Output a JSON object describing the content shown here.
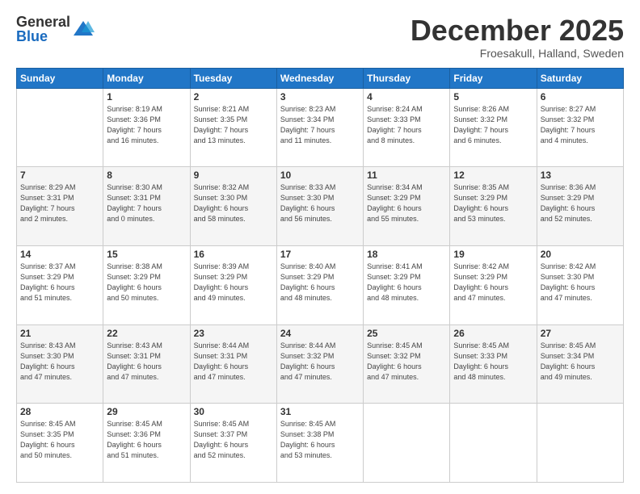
{
  "logo": {
    "general": "General",
    "blue": "Blue"
  },
  "header": {
    "month": "December 2025",
    "location": "Froesakull, Halland, Sweden"
  },
  "weekdays": [
    "Sunday",
    "Monday",
    "Tuesday",
    "Wednesday",
    "Thursday",
    "Friday",
    "Saturday"
  ],
  "weeks": [
    [
      {
        "day": "",
        "info": ""
      },
      {
        "day": "1",
        "info": "Sunrise: 8:19 AM\nSunset: 3:36 PM\nDaylight: 7 hours\nand 16 minutes."
      },
      {
        "day": "2",
        "info": "Sunrise: 8:21 AM\nSunset: 3:35 PM\nDaylight: 7 hours\nand 13 minutes."
      },
      {
        "day": "3",
        "info": "Sunrise: 8:23 AM\nSunset: 3:34 PM\nDaylight: 7 hours\nand 11 minutes."
      },
      {
        "day": "4",
        "info": "Sunrise: 8:24 AM\nSunset: 3:33 PM\nDaylight: 7 hours\nand 8 minutes."
      },
      {
        "day": "5",
        "info": "Sunrise: 8:26 AM\nSunset: 3:32 PM\nDaylight: 7 hours\nand 6 minutes."
      },
      {
        "day": "6",
        "info": "Sunrise: 8:27 AM\nSunset: 3:32 PM\nDaylight: 7 hours\nand 4 minutes."
      }
    ],
    [
      {
        "day": "7",
        "info": "Sunrise: 8:29 AM\nSunset: 3:31 PM\nDaylight: 7 hours\nand 2 minutes."
      },
      {
        "day": "8",
        "info": "Sunrise: 8:30 AM\nSunset: 3:31 PM\nDaylight: 7 hours\nand 0 minutes."
      },
      {
        "day": "9",
        "info": "Sunrise: 8:32 AM\nSunset: 3:30 PM\nDaylight: 6 hours\nand 58 minutes."
      },
      {
        "day": "10",
        "info": "Sunrise: 8:33 AM\nSunset: 3:30 PM\nDaylight: 6 hours\nand 56 minutes."
      },
      {
        "day": "11",
        "info": "Sunrise: 8:34 AM\nSunset: 3:29 PM\nDaylight: 6 hours\nand 55 minutes."
      },
      {
        "day": "12",
        "info": "Sunrise: 8:35 AM\nSunset: 3:29 PM\nDaylight: 6 hours\nand 53 minutes."
      },
      {
        "day": "13",
        "info": "Sunrise: 8:36 AM\nSunset: 3:29 PM\nDaylight: 6 hours\nand 52 minutes."
      }
    ],
    [
      {
        "day": "14",
        "info": "Sunrise: 8:37 AM\nSunset: 3:29 PM\nDaylight: 6 hours\nand 51 minutes."
      },
      {
        "day": "15",
        "info": "Sunrise: 8:38 AM\nSunset: 3:29 PM\nDaylight: 6 hours\nand 50 minutes."
      },
      {
        "day": "16",
        "info": "Sunrise: 8:39 AM\nSunset: 3:29 PM\nDaylight: 6 hours\nand 49 minutes."
      },
      {
        "day": "17",
        "info": "Sunrise: 8:40 AM\nSunset: 3:29 PM\nDaylight: 6 hours\nand 48 minutes."
      },
      {
        "day": "18",
        "info": "Sunrise: 8:41 AM\nSunset: 3:29 PM\nDaylight: 6 hours\nand 48 minutes."
      },
      {
        "day": "19",
        "info": "Sunrise: 8:42 AM\nSunset: 3:29 PM\nDaylight: 6 hours\nand 47 minutes."
      },
      {
        "day": "20",
        "info": "Sunrise: 8:42 AM\nSunset: 3:30 PM\nDaylight: 6 hours\nand 47 minutes."
      }
    ],
    [
      {
        "day": "21",
        "info": "Sunrise: 8:43 AM\nSunset: 3:30 PM\nDaylight: 6 hours\nand 47 minutes."
      },
      {
        "day": "22",
        "info": "Sunrise: 8:43 AM\nSunset: 3:31 PM\nDaylight: 6 hours\nand 47 minutes."
      },
      {
        "day": "23",
        "info": "Sunrise: 8:44 AM\nSunset: 3:31 PM\nDaylight: 6 hours\nand 47 minutes."
      },
      {
        "day": "24",
        "info": "Sunrise: 8:44 AM\nSunset: 3:32 PM\nDaylight: 6 hours\nand 47 minutes."
      },
      {
        "day": "25",
        "info": "Sunrise: 8:45 AM\nSunset: 3:32 PM\nDaylight: 6 hours\nand 47 minutes."
      },
      {
        "day": "26",
        "info": "Sunrise: 8:45 AM\nSunset: 3:33 PM\nDaylight: 6 hours\nand 48 minutes."
      },
      {
        "day": "27",
        "info": "Sunrise: 8:45 AM\nSunset: 3:34 PM\nDaylight: 6 hours\nand 49 minutes."
      }
    ],
    [
      {
        "day": "28",
        "info": "Sunrise: 8:45 AM\nSunset: 3:35 PM\nDaylight: 6 hours\nand 50 minutes."
      },
      {
        "day": "29",
        "info": "Sunrise: 8:45 AM\nSunset: 3:36 PM\nDaylight: 6 hours\nand 51 minutes."
      },
      {
        "day": "30",
        "info": "Sunrise: 8:45 AM\nSunset: 3:37 PM\nDaylight: 6 hours\nand 52 minutes."
      },
      {
        "day": "31",
        "info": "Sunrise: 8:45 AM\nSunset: 3:38 PM\nDaylight: 6 hours\nand 53 minutes."
      },
      {
        "day": "",
        "info": ""
      },
      {
        "day": "",
        "info": ""
      },
      {
        "day": "",
        "info": ""
      }
    ]
  ]
}
